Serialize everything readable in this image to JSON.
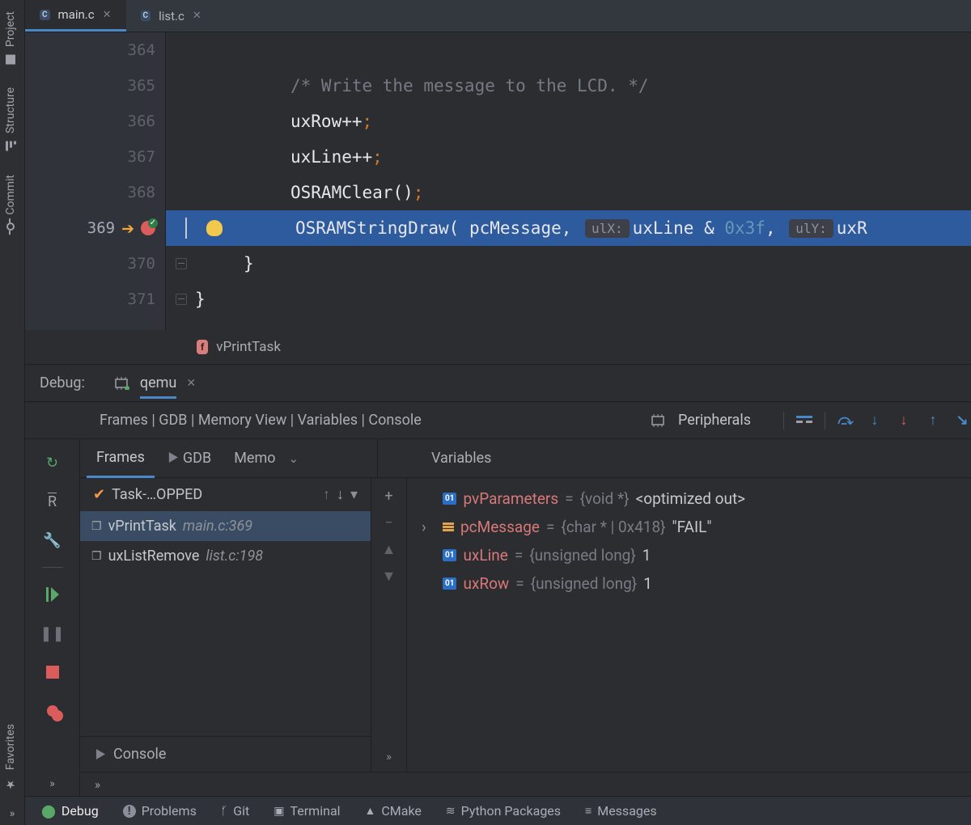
{
  "leftbar": {
    "items": [
      "Project",
      "Structure",
      "Commit",
      "Favorites"
    ]
  },
  "tabs": [
    {
      "label": "main.c",
      "active": true
    },
    {
      "label": "list.c",
      "active": false
    }
  ],
  "editor": {
    "lines": [
      {
        "n": "364",
        "html": ""
      },
      {
        "n": "365",
        "html": "comment",
        "text": "/* Write the message to the LCD. */"
      },
      {
        "n": "366",
        "text1": "uxRow",
        "text2": "++",
        "text3": ";"
      },
      {
        "n": "367",
        "text1": "uxLine",
        "text2": "++",
        "text3": ";"
      },
      {
        "n": "368",
        "text1": "OSRAMClear",
        "text2": "()",
        "text3": ";"
      },
      {
        "n": "369",
        "call": "OSRAMStringDraw",
        "open": "( ",
        "arg1": "pcMessage",
        "c1": ", ",
        "h1": "ulX:",
        "arg2": "uxLine",
        "amp": " & ",
        "hex": "0x3f",
        "c2": ", ",
        "h2": "ulY:",
        "arg3": "uxR"
      },
      {
        "n": "370",
        "brace": "}"
      },
      {
        "n": "371",
        "brace": "}"
      }
    ]
  },
  "breadcrumb": {
    "fn": "vPrintTask"
  },
  "debug": {
    "label": "Debug:",
    "config": "qemu",
    "layout": "Frames | GDB | Memory View | Variables | Console",
    "peripherals": "Peripherals",
    "framesTabs": {
      "frames": "Frames",
      "gdb": "GDB",
      "mem": "Memo"
    },
    "variablesHdr": "Variables",
    "thread": "Task-…OPPED",
    "stack": [
      {
        "fn": "vPrintTask",
        "loc": "main.c:369",
        "sel": true
      },
      {
        "fn": "uxListRemove",
        "loc": "list.c:198",
        "sel": false
      }
    ],
    "vars": [
      {
        "icon": "01",
        "name": "pvParameters",
        "eq": " = ",
        "type": "{void *}",
        "val": " <optimized out>"
      },
      {
        "icon": "obj",
        "expand": true,
        "name": "pcMessage",
        "eq": " = ",
        "type": "{char * | 0x418}",
        "val": " \"FAIL\""
      },
      {
        "icon": "01",
        "name": "uxLine",
        "eq": " = ",
        "type": "{unsigned long}",
        "val": " 1"
      },
      {
        "icon": "01",
        "name": "uxRow",
        "eq": " = ",
        "type": "{unsigned long}",
        "val": " 1"
      }
    ],
    "console": "Console"
  },
  "statusbar": {
    "items": [
      {
        "label": "Debug",
        "active": true,
        "icon": "bug"
      },
      {
        "label": "Problems",
        "icon": "!"
      },
      {
        "label": "Git",
        "icon": "branch"
      },
      {
        "label": "Terminal",
        "icon": "term"
      },
      {
        "label": "CMake",
        "icon": "tri"
      },
      {
        "label": "Python Packages",
        "icon": "stack"
      },
      {
        "label": "Messages",
        "icon": "msg"
      }
    ]
  }
}
